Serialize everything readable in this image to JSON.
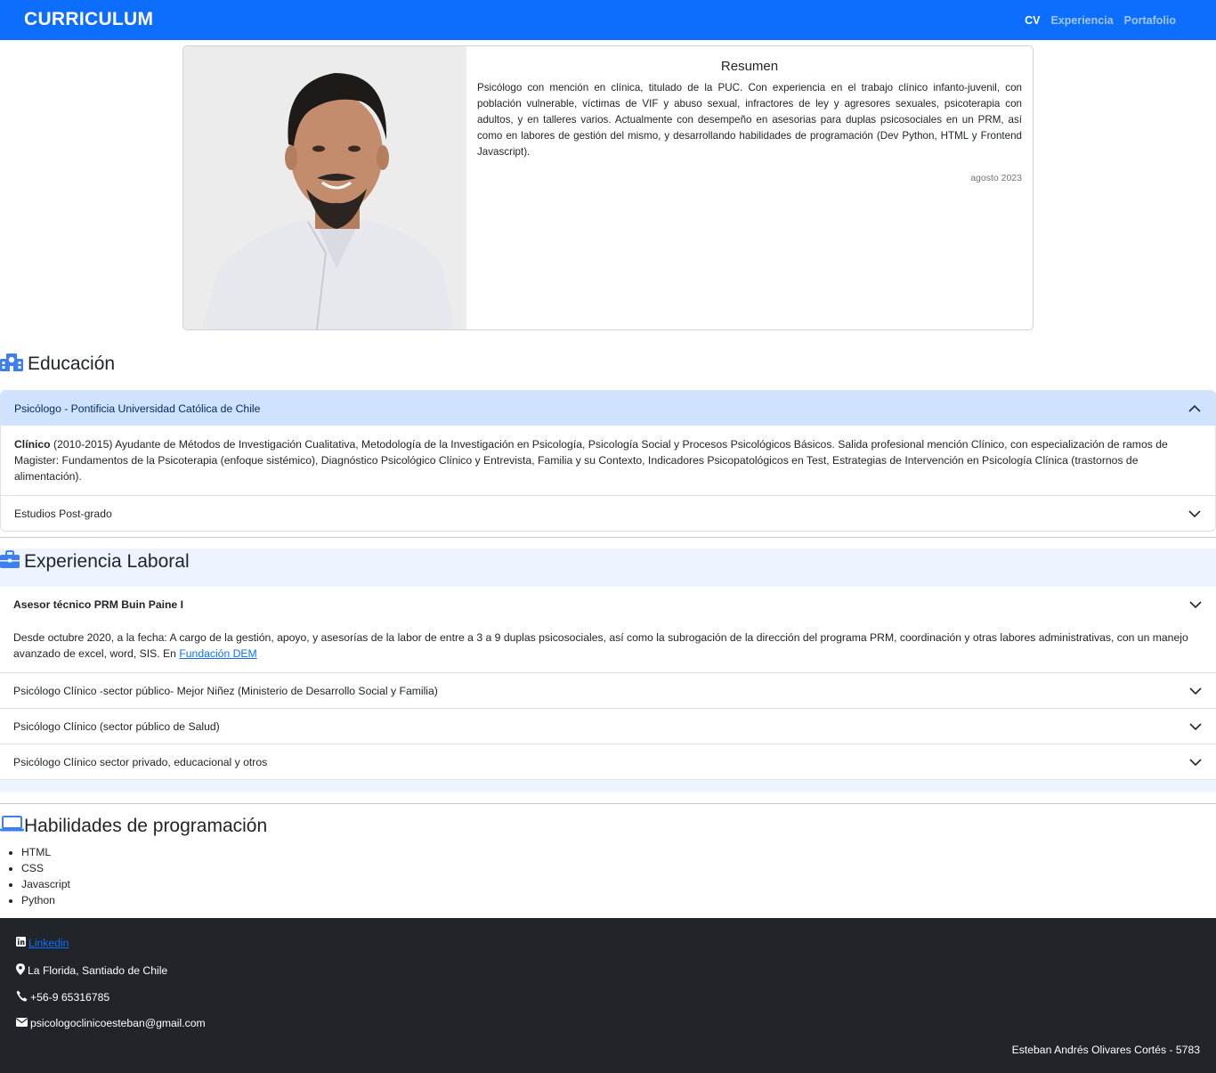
{
  "navbar": {
    "brand": "CURRICULUM",
    "links": [
      {
        "label": "CV",
        "active": true
      },
      {
        "label": "Experiencia",
        "active": false
      },
      {
        "label": "Portafolio",
        "active": false
      }
    ]
  },
  "resumen": {
    "title": "Resumen",
    "text": "Psicólogo con mención en clínica, titulado de la PUC. Con experiencia en el trabajo clínico infanto-juvenil, con población vulnerable, víctimas de VIF y abuso sexual, infractores de ley y agresores sexuales, psicoterapia con adultos, y en talleres varios. Actualmente con desempeño en asesorias para duplas psicosociales en un PRM, así como en labores de gestión del mismo, y desarrollando habilidades de programación (Dev Python, HTML y Frontend Javascript).",
    "date": "agosto 2023"
  },
  "educacion": {
    "title": "Educación",
    "icon": "school-icon",
    "items": [
      {
        "header": "Psicólogo - Pontificia Universidad Católica de Chile",
        "body_bold": "Clínico",
        "body_text": " (2010-2015) Ayudante de Métodos de Investigación Cualitativa, Metodología de la Investigación en Psicología, Psicología Social y Procesos Psicológicos Básicos. Salida profesional mención Clínico, con especialización de ramos de Magister: Fundamentos de la Psicoterapia (enfoque sistémico), Diagnóstico Psicológico Clínico y Entrevista, Familia y su Contexto, Indicadores Psicopatológicos en Test, Estrategias de Intervención en Psicología Clínica (trastornos de alimentación)."
      },
      {
        "header": "Estudios Post-grado"
      }
    ]
  },
  "experiencia": {
    "title": "Experiencia Laboral",
    "icon": "briefcase-icon",
    "items": [
      {
        "header": "Asesor técnico PRM Buin Paine I",
        "body_text": "Desde octubre 2020, a la fecha: A cargo de la gestión, apoyo, y asesorías de la labor de entre a 3 a 9 duplas psicosociales, así como la subrogación de la dirección del programa PRM, coordinación y otras labores administrativas, con un manejo avanzado de excel, word, SIS. En ",
        "link": "Fundación DEM"
      },
      {
        "header": "Psicólogo Clínico -sector público- Mejor Niñez (Ministerio de Desarrollo Social y Familia)"
      },
      {
        "header": "Psicólogo Clínico (sector público de Salud)"
      },
      {
        "header": "Psicólogo Clínico sector privado, educacional y otros"
      }
    ]
  },
  "habilidades": {
    "title": "Habilidades de programación",
    "icon": "laptop-icon",
    "items": [
      "HTML",
      "CSS",
      "Javascript",
      "Python"
    ]
  },
  "footer": {
    "linkedin": "Linkedin",
    "location": "La Florida, Santiado de Chile",
    "phone": "+56-9 65316785",
    "email": "psicologoclinicoesteban@gmail.com",
    "signature": "Esteban Andrés Olivares Cortés - 5783"
  },
  "colors": {
    "primary": "#0d6efd",
    "footer_bg": "#212529",
    "accordion_open": "#cfe2ff"
  }
}
